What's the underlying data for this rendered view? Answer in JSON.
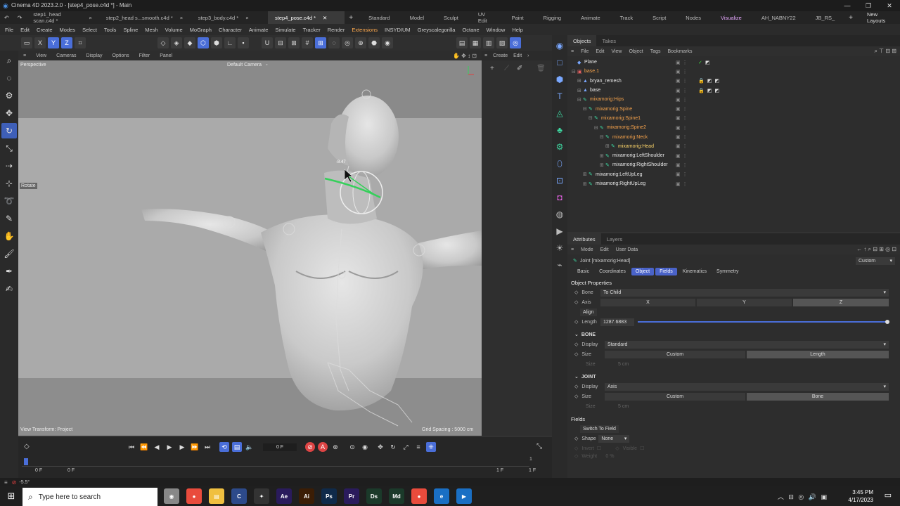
{
  "window": {
    "title": "Cinema 4D 2023.2.0 - [step4_pose.c4d *] - Main",
    "controls": [
      "—",
      "❐",
      "✕"
    ]
  },
  "doc_tabs": [
    {
      "label": "step1_head scan.c4d *",
      "close": "×"
    },
    {
      "label": "step2_head s...smooth.c4d *",
      "close": "×"
    },
    {
      "label": "step3_body.c4d *",
      "close": "×"
    },
    {
      "label": "step4_pose.c4d *",
      "close": "✕"
    }
  ],
  "layouts": [
    "Standard",
    "Model",
    "Sculpt",
    "UV Edit",
    "Paint",
    "Rigging",
    "Animate",
    "Track",
    "Script",
    "Nodes",
    "Visualize",
    "AH_NABNY22",
    "JB_RS_"
  ],
  "new_layouts": "New Layouts",
  "menu": [
    "File",
    "Edit",
    "Create",
    "Modes",
    "Select",
    "Tools",
    "Spline",
    "Mesh",
    "Volume",
    "MoGraph",
    "Character",
    "Animate",
    "Simulate",
    "Tracker",
    "Render",
    "Extensions",
    "INSYDIUM",
    "Greyscalegorilla",
    "Octane",
    "Window",
    "Help"
  ],
  "viewport": {
    "menu": [
      "View",
      "Cameras",
      "Display",
      "Options",
      "Filter",
      "Panel"
    ],
    "name": "Perspective",
    "camera": "Default Camera",
    "camera_icon": "◦",
    "tool_label": "Rotate",
    "view_transform": "View Transform: Project",
    "grid_spacing": "Grid Spacing : 5000 cm",
    "joint_value": "-8.47"
  },
  "right_toolbar": [
    "Create",
    "Edit"
  ],
  "objects_panel": {
    "tabs": [
      "Objects",
      "Takes"
    ],
    "menu": [
      "File",
      "Edit",
      "View",
      "Object",
      "Tags",
      "Bookmarks"
    ],
    "rows": [
      {
        "name": "Plane",
        "indent": 0,
        "color": "white",
        "exp": "",
        "icon": "◆"
      },
      {
        "name": "base.1",
        "indent": 0,
        "color": "orange",
        "exp": "⊟",
        "icon": "▣"
      },
      {
        "name": "bryan_remesh",
        "indent": 1,
        "color": "white",
        "exp": "⊞",
        "icon": "▲"
      },
      {
        "name": "base",
        "indent": 1,
        "color": "white",
        "exp": "⊞",
        "icon": "▲"
      },
      {
        "name": "mixamorig:Hips",
        "indent": 1,
        "color": "orange",
        "exp": "⊟",
        "icon": "✎"
      },
      {
        "name": "mixamorig:Spine",
        "indent": 2,
        "color": "orange",
        "exp": "⊟",
        "icon": "✎"
      },
      {
        "name": "mixamorig:Spine1",
        "indent": 3,
        "color": "orange",
        "exp": "⊟",
        "icon": "✎"
      },
      {
        "name": "mixamorig:Spine2",
        "indent": 4,
        "color": "orange",
        "exp": "⊟",
        "icon": "✎"
      },
      {
        "name": "mixamorig:Neck",
        "indent": 5,
        "color": "orange",
        "exp": "⊟",
        "icon": "✎"
      },
      {
        "name": "mixamorig:Head",
        "indent": 6,
        "color": "sel",
        "exp": "⊞",
        "icon": "✎"
      },
      {
        "name": "mixamorig:LeftShoulder",
        "indent": 5,
        "color": "white",
        "exp": "⊞",
        "icon": "✎"
      },
      {
        "name": "mixamorig:RightShoulder",
        "indent": 5,
        "color": "white",
        "exp": "⊞",
        "icon": "✎"
      },
      {
        "name": "mixamorig:LeftUpLeg",
        "indent": 2,
        "color": "white",
        "exp": "⊞",
        "icon": "✎"
      },
      {
        "name": "mixamorig:RightUpLeg",
        "indent": 2,
        "color": "white",
        "exp": "⊞",
        "icon": "✎"
      }
    ]
  },
  "attributes": {
    "tabs": [
      "Attributes",
      "Layers"
    ],
    "menu": [
      "Mode",
      "Edit",
      "User Data"
    ],
    "object_title": "Joint [mixamorig:Head]",
    "preset": "Custom",
    "subtabs": [
      "Basic",
      "Coordinates",
      "Object",
      "Fields",
      "Kinematics",
      "Symmetry"
    ],
    "section_title": "Object Properties",
    "bone_label": "Bone",
    "bone_value": "To Child",
    "axis_label": "Axis",
    "axis_options": [
      "X",
      "Y",
      "Z"
    ],
    "align_label": "Align",
    "length_label": "Length",
    "length_value": "1287.6883",
    "bone_section": "BONE",
    "display_label": "Display",
    "bone_display": "Standard",
    "size_label": "Size",
    "size_opts": [
      "Custom",
      "Length"
    ],
    "size_value": "5 cm",
    "joint_section": "JOINT",
    "joint_display": "Axis",
    "joint_size_opts": [
      "Custom",
      "Bone"
    ],
    "joint_size_value": "5 cm",
    "fields_section": "Fields",
    "switch_to_field": "Switch To Field",
    "shape_label": "Shape",
    "shape_value": "None",
    "invert_label": "Invert",
    "visible_label": "Visible",
    "weight_label": "Weight",
    "weight_value": "0 %"
  },
  "timeline": {
    "current_frame": "0 F",
    "start": "0 F",
    "start2": "0 F",
    "end": "1 F",
    "end2": "1 F",
    "marker": "1"
  },
  "status": {
    "text": "-5.5°"
  },
  "taskbar": {
    "search_placeholder": "Type here to search",
    "apps": [
      {
        "label": "◉",
        "color": "#888"
      },
      {
        "label": "●",
        "color": "#e94b3c"
      },
      {
        "label": "▤",
        "color": "#f0c040"
      },
      {
        "label": "C",
        "color": "#2d4a8a"
      },
      {
        "label": "✦",
        "color": "#333"
      },
      {
        "label": "Ae",
        "color": "#2a1b5c"
      },
      {
        "label": "Ai",
        "color": "#3b1d05"
      },
      {
        "label": "Ps",
        "color": "#0f2a4a"
      },
      {
        "label": "Pr",
        "color": "#2a1b5c"
      },
      {
        "label": "Ds",
        "color": "#1b3a2a"
      },
      {
        "label": "Md",
        "color": "#1b3a2a"
      },
      {
        "label": "●",
        "color": "#e94b3c"
      },
      {
        "label": "e",
        "color": "#1a6fc4"
      },
      {
        "label": "▶",
        "color": "#1a6fc4"
      }
    ],
    "tray": "︿  ⊟  ◎  🔊  ▣",
    "time": "3:45 PM",
    "date": "4/17/2023"
  }
}
